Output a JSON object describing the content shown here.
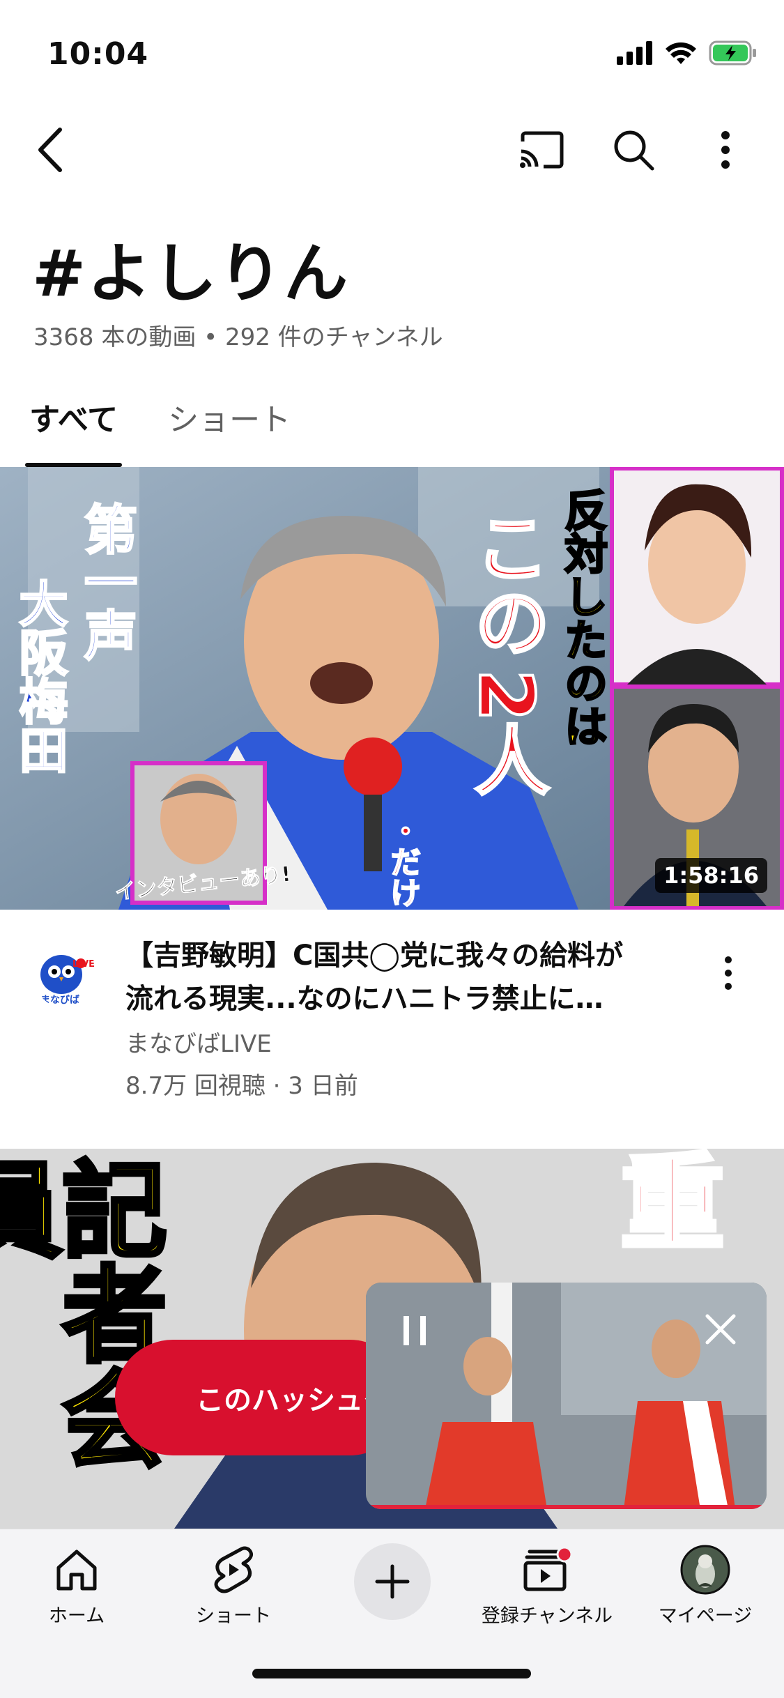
{
  "status_bar": {
    "time": "10:04"
  },
  "hashtag": {
    "title": "#よしりん",
    "subtitle": "3368 本の動画 • 292 件のチャンネル"
  },
  "tabs": [
    {
      "label": "すべて",
      "active": true
    },
    {
      "label": "ショート",
      "active": false
    }
  ],
  "videos": [
    {
      "duration": "1:58:16",
      "title_line1": "【吉野敏明】C国共◯党に我々の給料が",
      "title_line2": "流れる現実...なのにハニトラ禁止に…",
      "channel": "まなびばLIVE",
      "meta": "8.7万 回視聴 · 3 日前",
      "channel_avatar_text": "まなびば",
      "channel_avatar_badge": "LIVE",
      "thumbnail_text": {
        "left_vertical_1": "第一声",
        "left_vertical_2": "大阪梅田",
        "right_vertical": "反対したのは",
        "center_big_1": "この",
        "center_big_2": "2人",
        "center_small": "・だけ",
        "center_small_2": "・け",
        "inset_caption": "インタビューあり!"
      }
    },
    {
      "thumbnail_text": {
        "left_vertical": "記者会員",
        "right_top": "重"
      }
    }
  ],
  "create_pill": {
    "label": "このハッシュタグ"
  },
  "bottom_nav": [
    {
      "label": "ホーム",
      "icon": "home-icon"
    },
    {
      "label": "ショート",
      "icon": "shorts-icon"
    },
    {
      "label": "",
      "icon": "plus-icon"
    },
    {
      "label": "登録チャンネル",
      "icon": "subscriptions-icon"
    },
    {
      "label": "マイページ",
      "icon": "avatar-icon"
    }
  ],
  "colors": {
    "accent_red": "#d8102e",
    "thumbnail_yellow": "#ffe600",
    "thumbnail_red": "#e8141e",
    "thumbnail_blue": "#1c3fd8",
    "magenta_frame": "#d62fc8"
  }
}
